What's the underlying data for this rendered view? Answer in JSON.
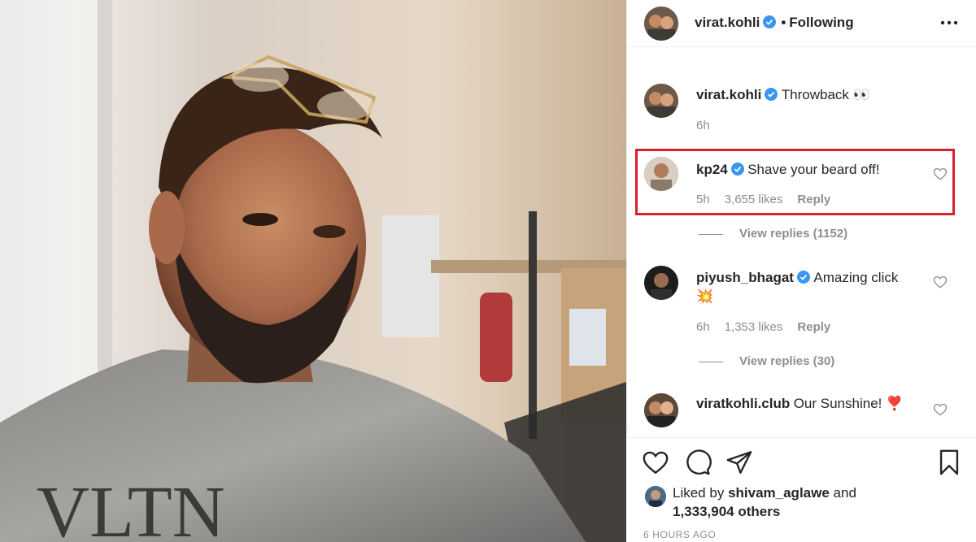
{
  "post": {
    "author": "virat.kohli",
    "follow_status": "Following",
    "dot": "•"
  },
  "caption": {
    "author": "virat.kohli",
    "text": "Throwback 👀",
    "time": "6h"
  },
  "comments": [
    {
      "author": "kp24",
      "text": "Shave your beard off!",
      "time": "5h",
      "likes": "3,655 likes",
      "reply": "Reply",
      "view_replies": "View replies (1152)",
      "highlighted": true
    },
    {
      "author": "piyush_bhagat",
      "text": "Amazing click",
      "emoji": "💥",
      "time": "6h",
      "likes": "1,353 likes",
      "reply": "Reply",
      "view_replies": "View replies (30)"
    },
    {
      "author": "viratkohli.club",
      "text": "Our Sunshine! ❣️"
    }
  ],
  "likes": {
    "prefix": "Liked by",
    "user": "shivam_aglawe",
    "and": "and",
    "others": "1,333,904 others"
  },
  "timestamp": "6 HOURS AGO",
  "icons": [
    "more-icon",
    "heart-icon",
    "comment-icon",
    "share-icon",
    "bookmark-icon",
    "verified-icon"
  ],
  "colors": {
    "verified": "#3897f0",
    "highlight": "#d8202a",
    "muted": "#8e8e8e",
    "text": "#262626"
  }
}
